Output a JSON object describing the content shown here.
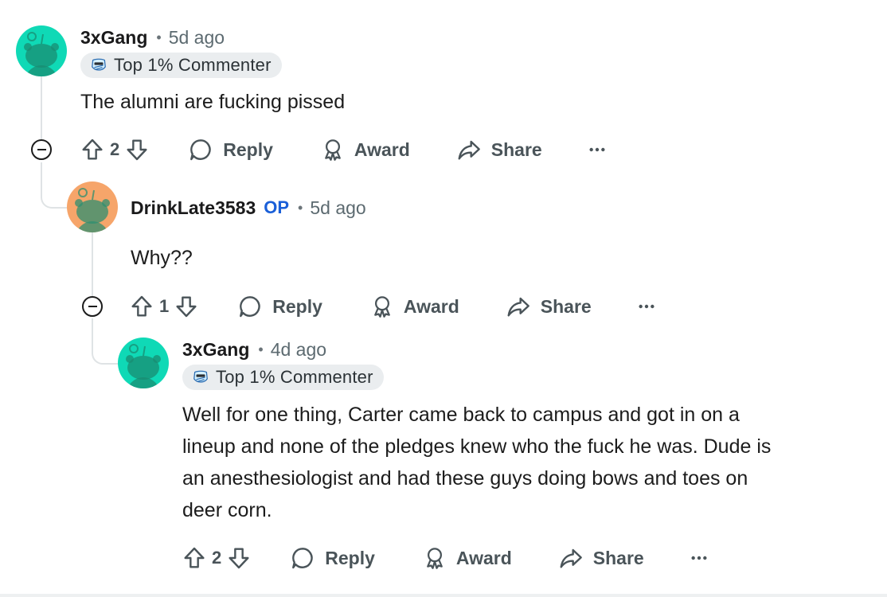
{
  "colors": {
    "avatar_teal": "#0fd9b6",
    "avatar_orange": "#f6a56a",
    "op_blue": "#1a5fd8",
    "badge_bg": "#eaedef",
    "thread_line": "#dfe3e5"
  },
  "icons": {
    "upvote": "arrow-up-outline",
    "downvote": "arrow-down-outline",
    "reply": "speech-bubble",
    "award": "award-ribbon",
    "share": "share-arrow",
    "more": "ellipsis",
    "collapse": "circle-minus",
    "badge": "commenter-badge"
  },
  "comments": [
    {
      "username": "3xGang",
      "separator": "•",
      "time": "5d ago",
      "badge": "Top 1% Commenter",
      "text": "The alumni are fucking pissed",
      "score": "2",
      "actions": {
        "reply": "Reply",
        "award": "Award",
        "share": "Share"
      }
    },
    {
      "username": "DrinkLate3583",
      "op": "OP",
      "separator": "•",
      "time": "5d ago",
      "text": "Why??",
      "score": "1",
      "actions": {
        "reply": "Reply",
        "award": "Award",
        "share": "Share"
      }
    },
    {
      "username": "3xGang",
      "separator": "•",
      "time": "4d ago",
      "badge": "Top 1% Commenter",
      "text_lines": [
        "Well for one thing, Carter came back to campus and got in on a",
        "lineup and none of the pledges knew who the fuck he was. Dude is",
        "an anesthesiologist and had these guys doing bows and toes on",
        "deer corn."
      ],
      "score": "2",
      "actions": {
        "reply": "Reply",
        "award": "Award",
        "share": "Share"
      }
    }
  ]
}
